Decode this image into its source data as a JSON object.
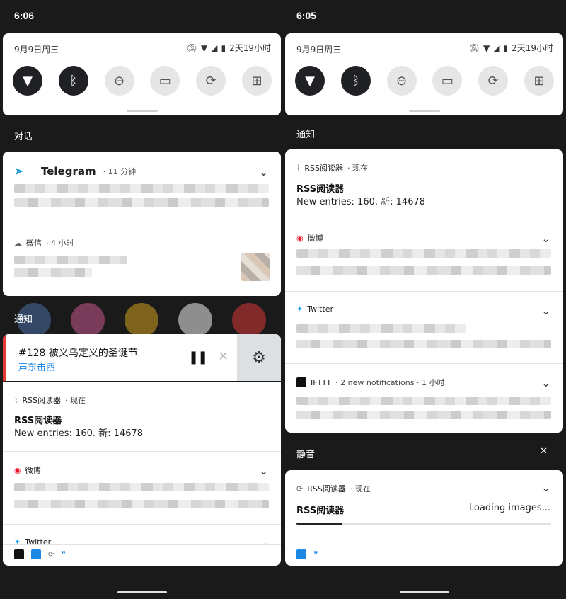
{
  "left": {
    "time": "6:06",
    "qs": {
      "date": "9月9日周三",
      "battery_text": "2天19小时"
    },
    "section_conversations": "对话",
    "telegram": {
      "app": "Telegram",
      "meta": "· 11 分钟"
    },
    "wechat": {
      "app": "微信",
      "meta": "· 4 小时"
    },
    "section_notifications": "通知",
    "media": {
      "title": "#128 被义乌定义的圣诞节",
      "subtitle": "声东击西",
      "pause": "❚❚",
      "close": "✕",
      "gear": "⚙"
    },
    "rss": {
      "app": "RSS阅读器",
      "meta": "· 现在",
      "title": "RSS阅读器",
      "body": "New entries: 160. 新: 14678"
    },
    "weibo": {
      "app": "微博"
    },
    "twitter": {
      "app": "Twitter"
    },
    "footer_icon_quote": "❞"
  },
  "right": {
    "time": "6:05",
    "qs": {
      "date": "9月9日周三",
      "battery_text": "2天19小时"
    },
    "section_notifications": "通知",
    "rss": {
      "app": "RSS阅读器",
      "meta": "· 现在",
      "title": "RSS阅读器",
      "body": "New entries: 160. 新: 14678"
    },
    "weibo": {
      "app": "微博"
    },
    "twitter": {
      "app": "Twitter"
    },
    "ifttt": {
      "app": "IFTTT",
      "meta": "· 2 new notifications · 1 小时"
    },
    "section_silent": "静音",
    "silent_close": "✕",
    "rss_loading": {
      "app": "RSS阅读器",
      "meta": "· 现在",
      "title": "RSS阅读器",
      "status": "Loading images...",
      "progress": 0.18
    },
    "footer_icon_quote": "❞"
  },
  "icons": {
    "wifi": "wifi-icon",
    "bluetooth": "bluetooth-icon",
    "dnd": "do-not-disturb-icon",
    "flashlight": "flashlight-icon",
    "rotate": "auto-rotate-icon",
    "battery": "battery-saver-icon"
  },
  "colors": {
    "media_accent": "#e53935",
    "media_link": "#1e88e5",
    "telegram": "#2a9fd8",
    "twitter": "#1da1f2",
    "weibo": "#e6162d"
  }
}
